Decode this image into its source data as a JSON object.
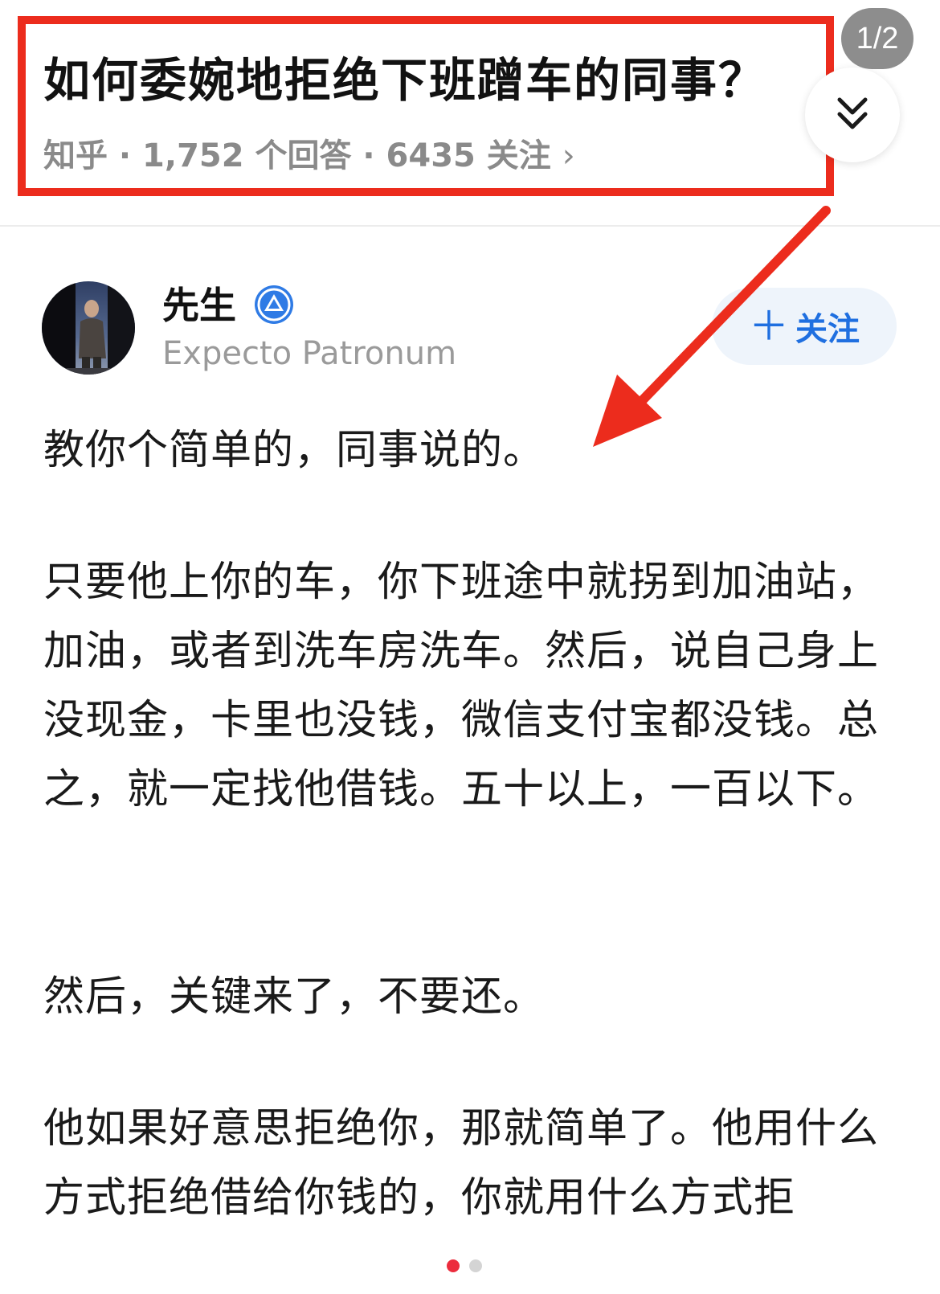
{
  "question": {
    "title": "如何委婉地拒绝下班蹭车的同事？",
    "meta": "知乎 · 1,752 个回答 · 6435 关注",
    "meta_chevron": "›"
  },
  "page_counter": "1/2",
  "author": {
    "name": "先生",
    "bio": "Expecto Patronum",
    "follow_label": "关注",
    "follow_plus": "＋"
  },
  "answer": {
    "paragraphs": [
      "教你个简单的，同事说的。",
      "只要他上你的车，你下班途中就拐到加油站，加油，或者到洗车房洗车。然后，说自己身上没现金，卡里也没钱，微信支付宝都没钱。总之，就一定找他借钱。五十以上，一百以下。",
      "然后，关键来了，不要还。",
      "他如果好意思拒绝你，那就简单了。他用什么方式拒绝借给你钱的，你就用什么方式拒"
    ]
  },
  "colors": {
    "annotation_red": "#ec2c1d",
    "link_blue": "#1f6fe0",
    "meta_gray": "#8a8a8a"
  },
  "icons": {
    "expand": "double-chevron-down-icon",
    "verified": "verified-badge-icon"
  },
  "pagination": {
    "active_index": 0,
    "total": 2
  }
}
